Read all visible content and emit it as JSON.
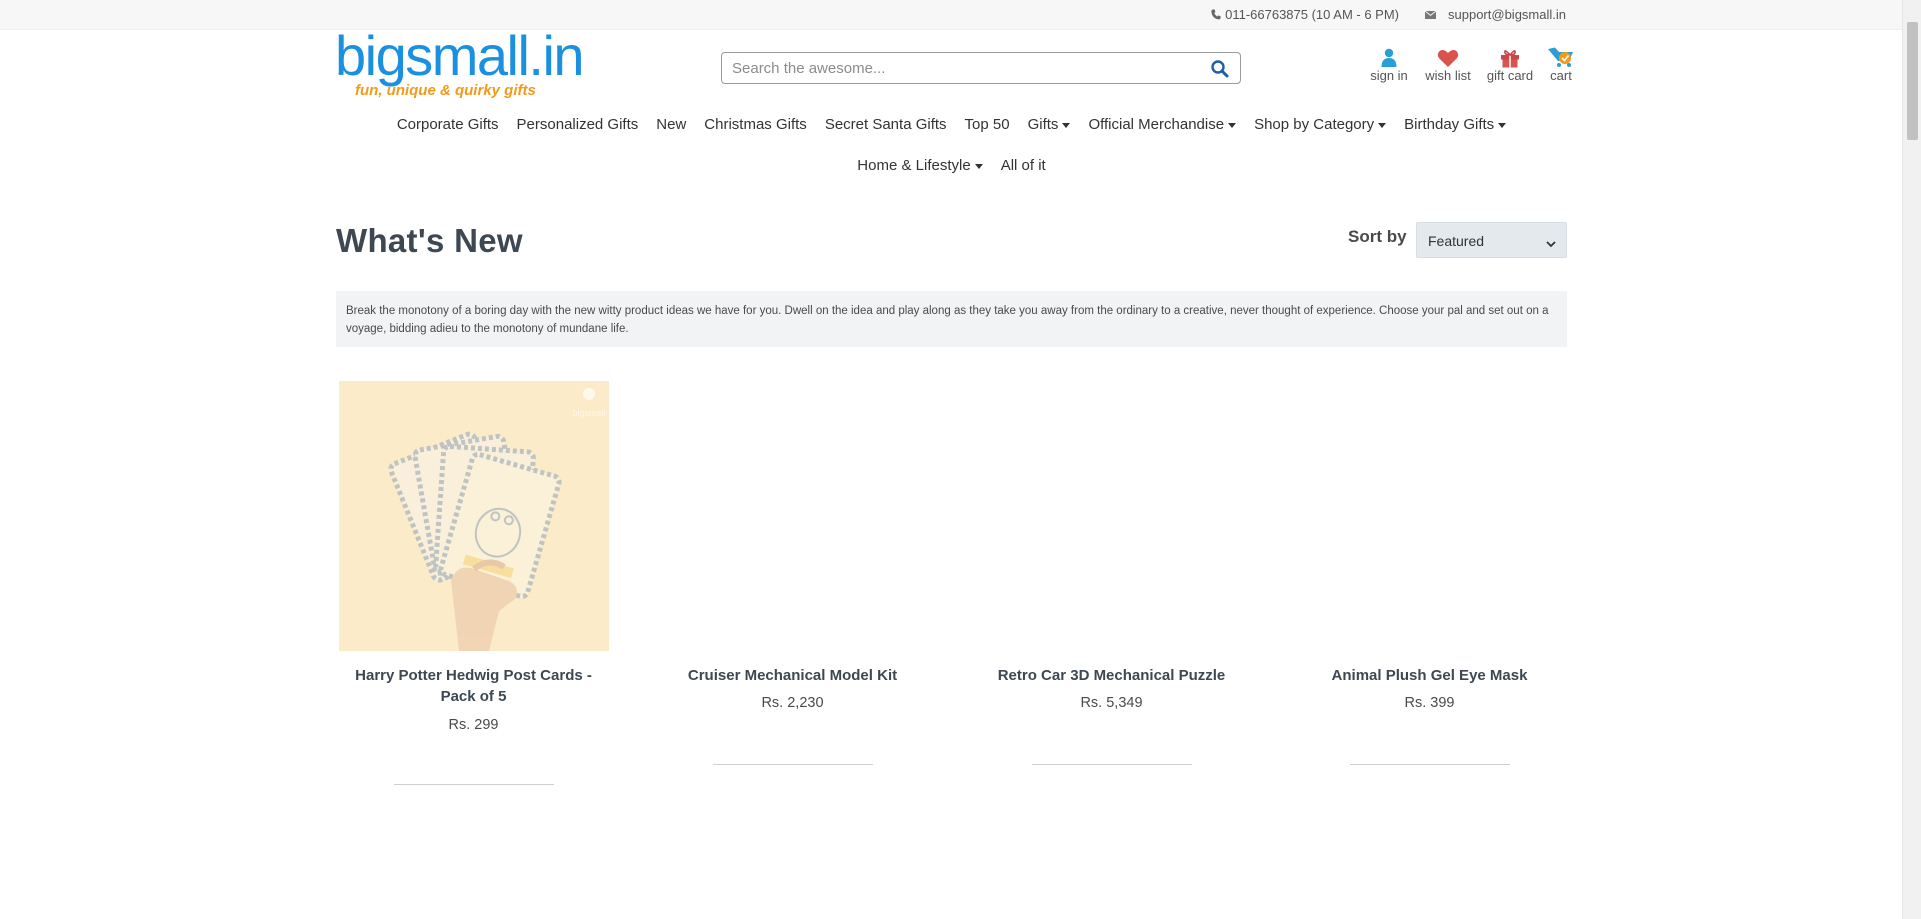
{
  "topbar": {
    "phone": "011-66763875 (10 AM - 6 PM)",
    "email": "support@bigsmall.in"
  },
  "logo": {
    "wordmark": "bigsmall.in",
    "tagline": "fun, unique & quirky gifts",
    "brand_color": "#1b8fe0",
    "tagline_color": "#f49a1a"
  },
  "search": {
    "placeholder": "Search the awesome...",
    "icon": "search-icon"
  },
  "header_actions": [
    {
      "label": "sign in",
      "icon": "user-icon",
      "color": "#2a9fd6"
    },
    {
      "label": "wish list",
      "icon": "heart-icon",
      "color": "#d9534f"
    },
    {
      "label": "gift card",
      "icon": "gift-icon",
      "color": "#d9534f"
    },
    {
      "label": "cart",
      "icon": "cart-icon",
      "color": "#2a9fd6"
    }
  ],
  "nav": {
    "row1": [
      {
        "label": "Corporate Gifts",
        "dropdown": false
      },
      {
        "label": "Personalized Gifts",
        "dropdown": false
      },
      {
        "label": "New",
        "dropdown": false
      },
      {
        "label": "Christmas Gifts",
        "dropdown": false
      },
      {
        "label": "Secret Santa Gifts",
        "dropdown": false
      },
      {
        "label": "Top 50",
        "dropdown": false
      },
      {
        "label": "Gifts",
        "dropdown": true
      },
      {
        "label": "Official Merchandise",
        "dropdown": true
      },
      {
        "label": "Shop by Category",
        "dropdown": true
      },
      {
        "label": "Birthday Gifts",
        "dropdown": true
      }
    ],
    "row2": [
      {
        "label": "Home & Lifestyle",
        "dropdown": true
      },
      {
        "label": "All of it",
        "dropdown": false
      }
    ]
  },
  "page": {
    "title": "What's New",
    "sort_label": "Sort by",
    "sort_value": "Featured",
    "description": "Break the monotony of a boring day with the new witty product ideas we have for you. Dwell on the idea and play along as they take you away from the ordinary to a creative, never thought of experience. Choose your pal and set out on a voyage, bidding adieu to the monotony of mundane life."
  },
  "products": [
    {
      "name": "Harry Potter Hedwig Post Cards - Pack of 5",
      "price": "Rs. 299",
      "has_image": true
    },
    {
      "name": "Cruiser Mechanical Model Kit",
      "price": "Rs. 2,230",
      "has_image": false
    },
    {
      "name": "Retro Car 3D Mechanical Puzzle",
      "price": "Rs. 5,349",
      "has_image": false
    },
    {
      "name": "Animal Plush Gel Eye Mask",
      "price": "Rs. 399",
      "has_image": false
    }
  ]
}
